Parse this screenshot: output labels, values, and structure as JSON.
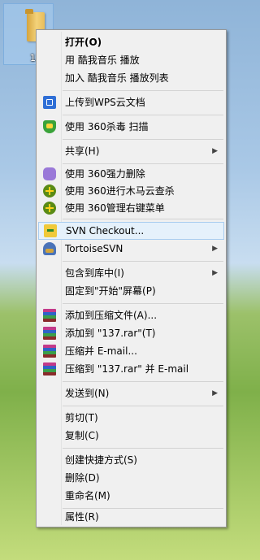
{
  "desktop": {
    "folder_label": "137"
  },
  "menu": {
    "items": [
      {
        "label": "打开(O)"
      },
      {
        "label": "用 酷我音乐 播放"
      },
      {
        "label": "加入 酷我音乐 播放列表"
      },
      {
        "label": "上传到WPS云文档",
        "icon": "wps-cloud-icon"
      },
      {
        "label": "使用 360杀毒 扫描",
        "icon": "360-shield-icon"
      },
      {
        "label": "共享(H)"
      },
      {
        "label": "使用 360强力删除",
        "icon": "360-delete-icon"
      },
      {
        "label": "使用 360进行木马云查杀",
        "icon": "360-plus-icon"
      },
      {
        "label": "使用 360管理右键菜单",
        "icon": "360-plus-icon"
      },
      {
        "label": "SVN Checkout...",
        "icon": "svn-checkout-icon"
      },
      {
        "label": "TortoiseSVN",
        "icon": "tortoisesvn-icon"
      },
      {
        "label": "包含到库中(I)"
      },
      {
        "label": "固定到\"开始\"屏幕(P)"
      },
      {
        "label": "添加到压缩文件(A)...",
        "icon": "winrar-icon"
      },
      {
        "label": "添加到 \"137.rar\"(T)",
        "icon": "winrar-icon"
      },
      {
        "label": "压缩并 E-mail...",
        "icon": "winrar-icon"
      },
      {
        "label": "压缩到 \"137.rar\" 并 E-mail",
        "icon": "winrar-icon"
      },
      {
        "label": "发送到(N)"
      },
      {
        "label": "剪切(T)"
      },
      {
        "label": "复制(C)"
      },
      {
        "label": "创建快捷方式(S)"
      },
      {
        "label": "删除(D)"
      },
      {
        "label": "重命名(M)"
      },
      {
        "label": "属性(R)"
      }
    ],
    "submenu_arrow": "▶",
    "hovered_item": "SVN Checkout..."
  }
}
